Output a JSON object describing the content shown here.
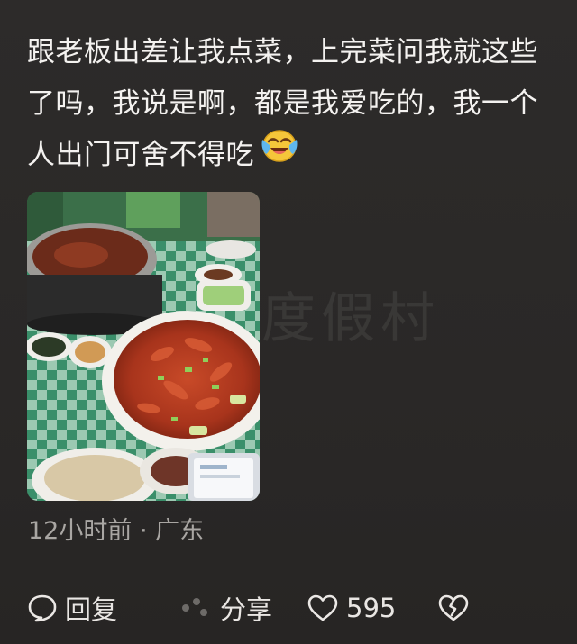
{
  "post": {
    "text": "跟老板出差让我点菜，上完菜问我就这些了吗，我说是啊，都是我爱吃的，我一个人出门可舍不得吃",
    "emoji_icon": "crying-laughing-face-icon",
    "photo_alt": "crayfish-dinner-photo",
    "meta": "12小时前 · 广东"
  },
  "watermark": "度假村",
  "actions": {
    "reply_label": "回复",
    "share_label": "分享",
    "like_count": "595",
    "reply_icon": "speech-bubble-icon",
    "share_icon": "share-icon",
    "like_icon": "heart-outline-icon",
    "dislike_icon": "broken-heart-icon"
  },
  "colors": {
    "background": "#2a2827",
    "text": "#f4f2f0",
    "meta": "#a9a6a3"
  }
}
